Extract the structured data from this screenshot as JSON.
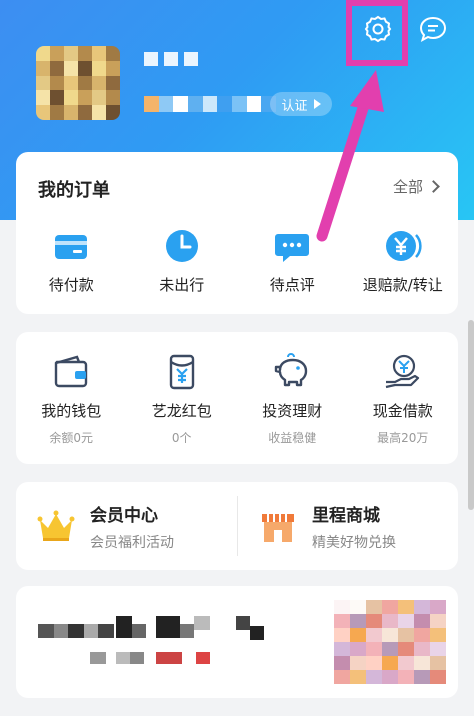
{
  "header": {
    "verify_label": "认证",
    "colors": {
      "accent": "#e23fae",
      "gradient_start": "#3d8ef2",
      "gradient_end": "#28c6f4"
    }
  },
  "orders": {
    "title": "我的订单",
    "all_label": "全部",
    "items": [
      {
        "label": "待付款",
        "icon": "card-icon"
      },
      {
        "label": "未出行",
        "icon": "clock-icon"
      },
      {
        "label": "待点评",
        "icon": "comment-icon"
      },
      {
        "label": "退赔款/转让",
        "icon": "yen-coin-icon"
      }
    ]
  },
  "wallet": {
    "items": [
      {
        "label": "我的钱包",
        "sub": "余额0元",
        "icon": "wallet-icon"
      },
      {
        "label": "艺龙红包",
        "sub": "0个",
        "icon": "red-packet-icon"
      },
      {
        "label": "投资理财",
        "sub": "收益稳健",
        "icon": "piggy-bank-icon"
      },
      {
        "label": "现金借款",
        "sub": "最高20万",
        "icon": "cash-hand-icon"
      }
    ]
  },
  "member": {
    "left": {
      "title": "会员中心",
      "sub": "会员福利活动",
      "icon": "crown-icon"
    },
    "right": {
      "title": "里程商城",
      "sub": "精美好物兑换",
      "icon": "shop-icon"
    }
  }
}
